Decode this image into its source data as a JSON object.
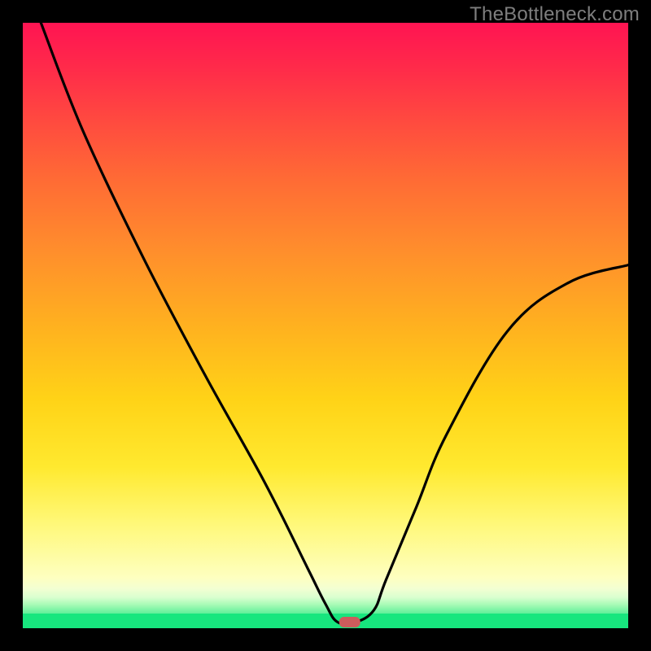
{
  "watermark": "TheBottleneck.com",
  "colors": {
    "frame": "#000000",
    "gradient_top": "#ff1452",
    "gradient_bottom_fade": "#feffc0",
    "green_strip": "#17e67e",
    "curve_stroke": "#000000",
    "marker_fill": "#cd5c5c",
    "watermark_text": "#7e7e7e"
  },
  "chart_data": {
    "type": "line",
    "title": "",
    "xlabel": "",
    "ylabel": "",
    "xlim": [
      0,
      100
    ],
    "ylim": [
      0,
      100
    ],
    "x": [
      3,
      10,
      20,
      30,
      40,
      47,
      50,
      52,
      55,
      58,
      60,
      65,
      70,
      80,
      90,
      100
    ],
    "y": [
      100,
      82,
      61,
      42,
      24,
      10,
      4,
      1,
      1,
      3,
      8,
      20,
      32,
      49,
      57,
      60
    ],
    "marker": {
      "x": 54,
      "y": 1,
      "shape": "rounded-rect"
    },
    "annotations": []
  }
}
